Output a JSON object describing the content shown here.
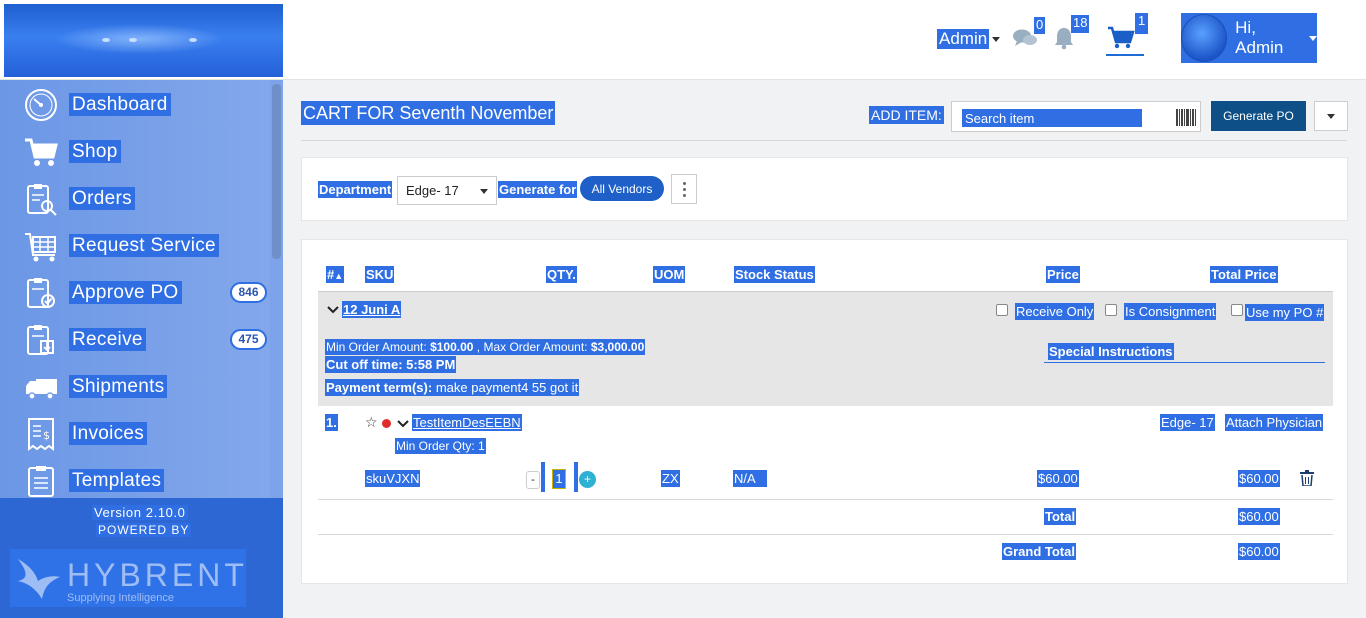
{
  "header": {
    "admin_label": "Admin",
    "chat_count": "0",
    "notification_count": "18",
    "cart_count": "1",
    "user_greeting": "Hi, Admin"
  },
  "sidebar": {
    "items": [
      {
        "label": "Dashboard",
        "icon": "dashboard-icon"
      },
      {
        "label": "Shop",
        "icon": "cart-icon"
      },
      {
        "label": "Orders",
        "icon": "orders-icon"
      },
      {
        "label": "Request Service",
        "icon": "request-service-icon"
      },
      {
        "label": "Approve PO",
        "icon": "approve-po-icon",
        "badge": "846"
      },
      {
        "label": "Receive",
        "icon": "receive-icon",
        "badge": "475"
      },
      {
        "label": "Shipments",
        "icon": "truck-icon"
      },
      {
        "label": "Invoices",
        "icon": "invoice-icon"
      },
      {
        "label": "Templates",
        "icon": "templates-icon"
      }
    ],
    "version": "Version 2.10.0",
    "powered_by": "POWERED BY",
    "brand": "HYBRENT",
    "brand_tagline": "Supplying Intelligence"
  },
  "main": {
    "title": "CART FOR Seventh November",
    "add_item_label": "ADD ITEM:",
    "search_placeholder": "Search item",
    "generate_po_label": "Generate PO"
  },
  "filters": {
    "department_label": "Department",
    "department_value": "Edge- 17",
    "generate_for_label": "Generate for",
    "vendor_value": "All Vendors"
  },
  "table": {
    "columns": {
      "num": "#",
      "sku": "SKU",
      "qty": "QTY.",
      "uom": "UOM",
      "stock": "Stock Status",
      "price": "Price",
      "total_price": "Total Price"
    },
    "vendor": {
      "name": "12 Juni A",
      "receive_only": "Receive Only",
      "consignment": "Is Consignment",
      "use_my_po": "Use my PO #",
      "min_order_label": "Min Order Amount:",
      "min_order_value": "$100.00",
      "max_order_label": "Max Order Amount:",
      "max_order_value": "$3,000.00",
      "cutoff_label": "Cut off time:",
      "cutoff_value": "5:58 PM",
      "payment_label": "Payment term(s):",
      "payment_value": "make payment4 55 got it",
      "special_instructions": "Special Instructions"
    },
    "item": {
      "index": "1.",
      "name": "TestItemDesEEBN",
      "min_order_qty": "Min Order Qty: 1",
      "department": "Edge- 17",
      "attach": "Attach Physician",
      "sku": "skuVJXN",
      "qty": "1",
      "uom": "ZX",
      "stock_status": "N/A",
      "price": "$60.00",
      "total_price": "$60.00"
    },
    "total_label": "Total",
    "total_value": "$60.00",
    "grand_total_label": "Grand Total",
    "grand_total_value": "$60.00"
  }
}
